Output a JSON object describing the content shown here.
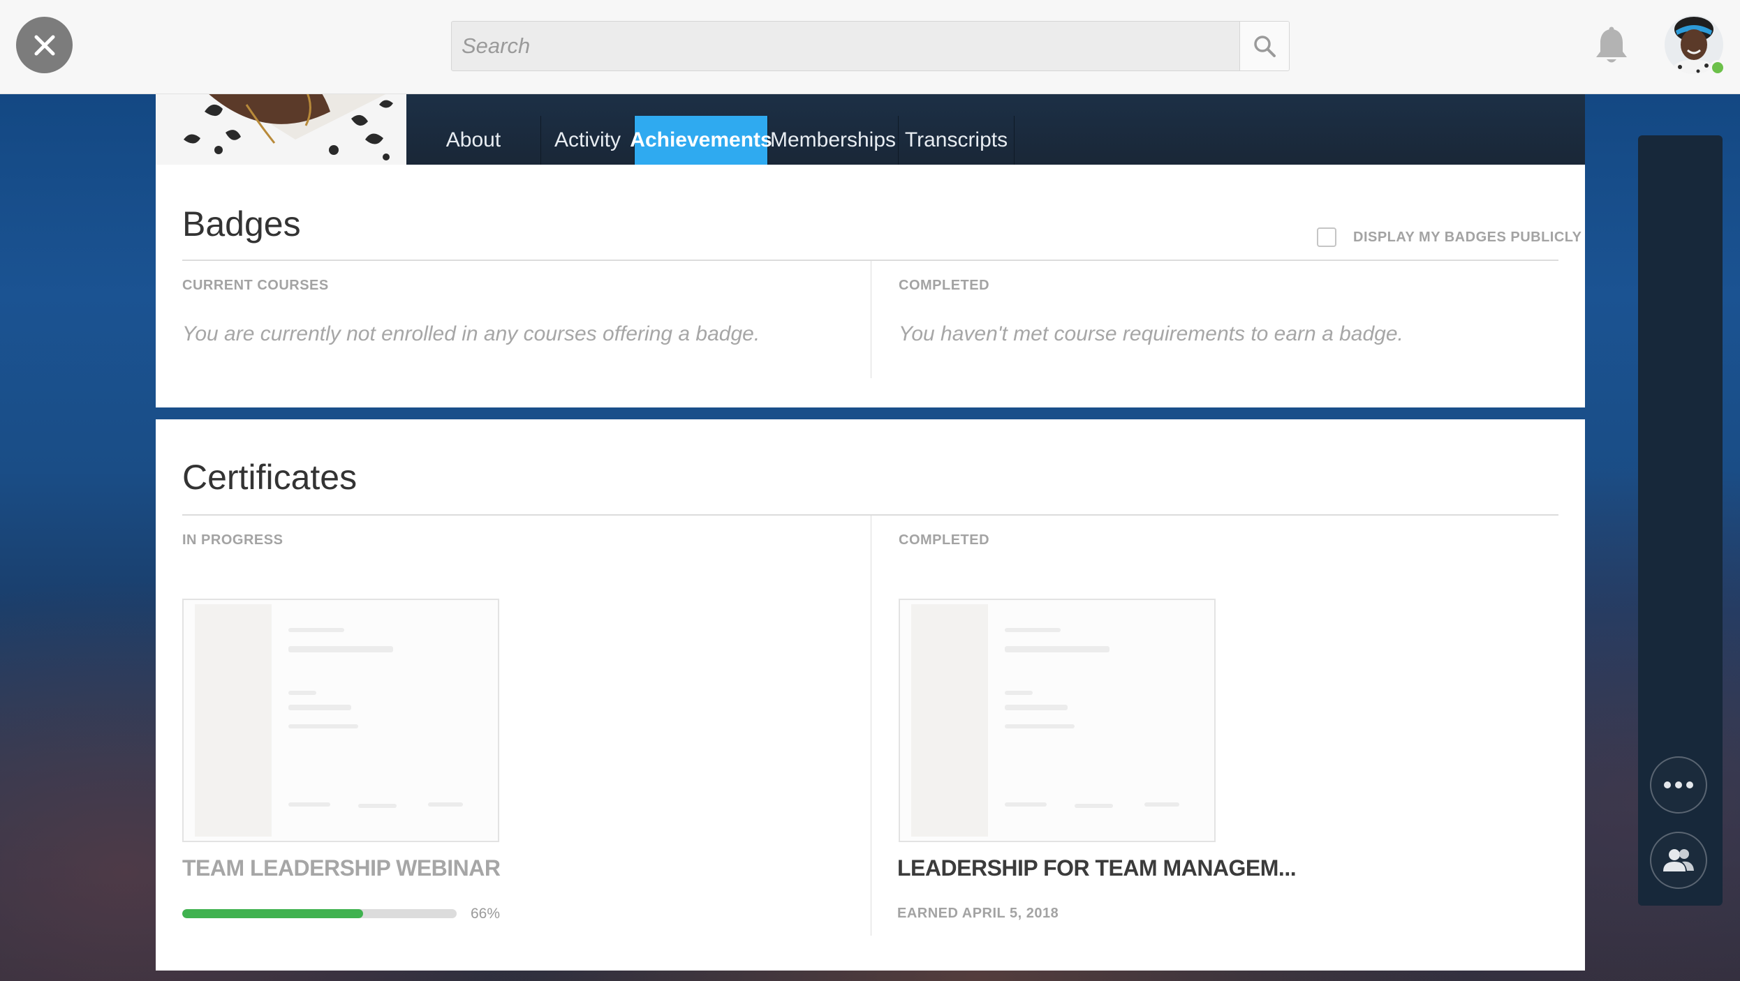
{
  "header": {
    "search_placeholder": "Search",
    "icons": {
      "close": "close-icon",
      "search": "search-icon",
      "notifications": "bell-icon",
      "avatar": "user-avatar"
    },
    "online_status_color": "#6cc04a"
  },
  "tabs": [
    {
      "label": "About",
      "active": false
    },
    {
      "label": "Activity",
      "active": false
    },
    {
      "label": "Achievements",
      "active": true
    },
    {
      "label": "Memberships",
      "active": false
    },
    {
      "label": "Transcripts",
      "active": false
    }
  ],
  "badges": {
    "title": "Badges",
    "display_publicly_label": "DISPLAY MY BADGES PUBLICLY",
    "display_publicly_checked": false,
    "current_courses_label": "CURRENT COURSES",
    "current_courses_empty": "You are currently not enrolled in any courses offering a badge.",
    "completed_label": "COMPLETED",
    "completed_empty": "You haven't met course requirements to earn a badge."
  },
  "certificates": {
    "title": "Certificates",
    "in_progress_label": "IN PROGRESS",
    "completed_label": "COMPLETED",
    "in_progress": [
      {
        "title": "TEAM LEADERSHIP WEBINAR",
        "progress_percent": 66,
        "progress_text": "66%"
      }
    ],
    "completed": [
      {
        "title": "LEADERSHIP FOR TEAM MANAGEM...",
        "earned": "EARNED APRIL 5, 2018"
      }
    ]
  },
  "side_rail": {
    "icons": [
      "more-icon",
      "people-icon"
    ]
  },
  "colors": {
    "accent_tab": "#2faaf0",
    "progress": "#3fb24f"
  }
}
